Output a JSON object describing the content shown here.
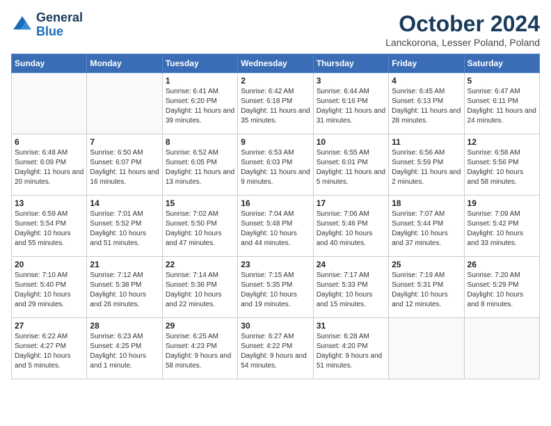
{
  "header": {
    "logo_line1": "General",
    "logo_line2": "Blue",
    "month": "October 2024",
    "location": "Lanckorona, Lesser Poland, Poland"
  },
  "days_of_week": [
    "Sunday",
    "Monday",
    "Tuesday",
    "Wednesday",
    "Thursday",
    "Friday",
    "Saturday"
  ],
  "weeks": [
    [
      {
        "day": "",
        "text": ""
      },
      {
        "day": "",
        "text": ""
      },
      {
        "day": "1",
        "text": "Sunrise: 6:41 AM\nSunset: 6:20 PM\nDaylight: 11 hours and 39 minutes."
      },
      {
        "day": "2",
        "text": "Sunrise: 6:42 AM\nSunset: 6:18 PM\nDaylight: 11 hours and 35 minutes."
      },
      {
        "day": "3",
        "text": "Sunrise: 6:44 AM\nSunset: 6:16 PM\nDaylight: 11 hours and 31 minutes."
      },
      {
        "day": "4",
        "text": "Sunrise: 6:45 AM\nSunset: 6:13 PM\nDaylight: 11 hours and 28 minutes."
      },
      {
        "day": "5",
        "text": "Sunrise: 6:47 AM\nSunset: 6:11 PM\nDaylight: 11 hours and 24 minutes."
      }
    ],
    [
      {
        "day": "6",
        "text": "Sunrise: 6:48 AM\nSunset: 6:09 PM\nDaylight: 11 hours and 20 minutes."
      },
      {
        "day": "7",
        "text": "Sunrise: 6:50 AM\nSunset: 6:07 PM\nDaylight: 11 hours and 16 minutes."
      },
      {
        "day": "8",
        "text": "Sunrise: 6:52 AM\nSunset: 6:05 PM\nDaylight: 11 hours and 13 minutes."
      },
      {
        "day": "9",
        "text": "Sunrise: 6:53 AM\nSunset: 6:03 PM\nDaylight: 11 hours and 9 minutes."
      },
      {
        "day": "10",
        "text": "Sunrise: 6:55 AM\nSunset: 6:01 PM\nDaylight: 11 hours and 5 minutes."
      },
      {
        "day": "11",
        "text": "Sunrise: 6:56 AM\nSunset: 5:59 PM\nDaylight: 11 hours and 2 minutes."
      },
      {
        "day": "12",
        "text": "Sunrise: 6:58 AM\nSunset: 5:56 PM\nDaylight: 10 hours and 58 minutes."
      }
    ],
    [
      {
        "day": "13",
        "text": "Sunrise: 6:59 AM\nSunset: 5:54 PM\nDaylight: 10 hours and 55 minutes."
      },
      {
        "day": "14",
        "text": "Sunrise: 7:01 AM\nSunset: 5:52 PM\nDaylight: 10 hours and 51 minutes."
      },
      {
        "day": "15",
        "text": "Sunrise: 7:02 AM\nSunset: 5:50 PM\nDaylight: 10 hours and 47 minutes."
      },
      {
        "day": "16",
        "text": "Sunrise: 7:04 AM\nSunset: 5:48 PM\nDaylight: 10 hours and 44 minutes."
      },
      {
        "day": "17",
        "text": "Sunrise: 7:06 AM\nSunset: 5:46 PM\nDaylight: 10 hours and 40 minutes."
      },
      {
        "day": "18",
        "text": "Sunrise: 7:07 AM\nSunset: 5:44 PM\nDaylight: 10 hours and 37 minutes."
      },
      {
        "day": "19",
        "text": "Sunrise: 7:09 AM\nSunset: 5:42 PM\nDaylight: 10 hours and 33 minutes."
      }
    ],
    [
      {
        "day": "20",
        "text": "Sunrise: 7:10 AM\nSunset: 5:40 PM\nDaylight: 10 hours and 29 minutes."
      },
      {
        "day": "21",
        "text": "Sunrise: 7:12 AM\nSunset: 5:38 PM\nDaylight: 10 hours and 26 minutes."
      },
      {
        "day": "22",
        "text": "Sunrise: 7:14 AM\nSunset: 5:36 PM\nDaylight: 10 hours and 22 minutes."
      },
      {
        "day": "23",
        "text": "Sunrise: 7:15 AM\nSunset: 5:35 PM\nDaylight: 10 hours and 19 minutes."
      },
      {
        "day": "24",
        "text": "Sunrise: 7:17 AM\nSunset: 5:33 PM\nDaylight: 10 hours and 15 minutes."
      },
      {
        "day": "25",
        "text": "Sunrise: 7:19 AM\nSunset: 5:31 PM\nDaylight: 10 hours and 12 minutes."
      },
      {
        "day": "26",
        "text": "Sunrise: 7:20 AM\nSunset: 5:29 PM\nDaylight: 10 hours and 8 minutes."
      }
    ],
    [
      {
        "day": "27",
        "text": "Sunrise: 6:22 AM\nSunset: 4:27 PM\nDaylight: 10 hours and 5 minutes."
      },
      {
        "day": "28",
        "text": "Sunrise: 6:23 AM\nSunset: 4:25 PM\nDaylight: 10 hours and 1 minute."
      },
      {
        "day": "29",
        "text": "Sunrise: 6:25 AM\nSunset: 4:23 PM\nDaylight: 9 hours and 58 minutes."
      },
      {
        "day": "30",
        "text": "Sunrise: 6:27 AM\nSunset: 4:22 PM\nDaylight: 9 hours and 54 minutes."
      },
      {
        "day": "31",
        "text": "Sunrise: 6:28 AM\nSunset: 4:20 PM\nDaylight: 9 hours and 51 minutes."
      },
      {
        "day": "",
        "text": ""
      },
      {
        "day": "",
        "text": ""
      }
    ]
  ]
}
